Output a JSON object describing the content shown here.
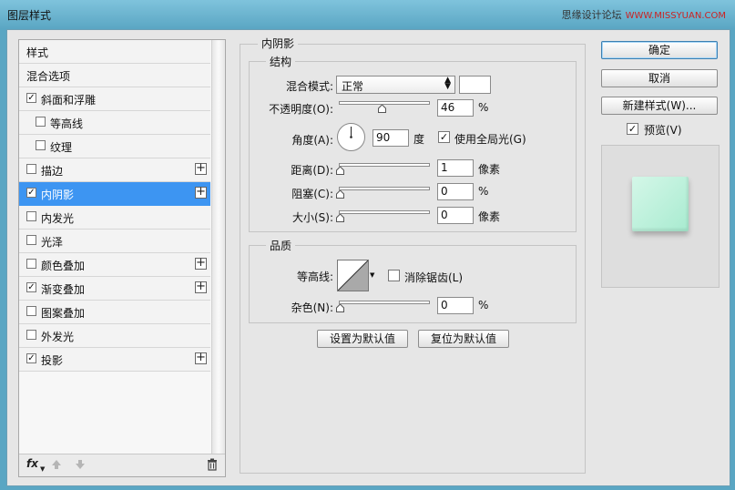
{
  "window": {
    "title": "图层样式"
  },
  "watermark": {
    "site": "思缘设计论坛",
    "url": "WWW.MISSYUAN.COM"
  },
  "style_list": {
    "items": [
      {
        "label": "样式",
        "checkbox": false,
        "checked": false,
        "indent": false,
        "plus": false,
        "selected": false
      },
      {
        "label": "混合选项",
        "checkbox": false,
        "checked": false,
        "indent": false,
        "plus": false,
        "selected": false
      },
      {
        "label": "斜面和浮雕",
        "checkbox": true,
        "checked": true,
        "indent": false,
        "plus": false,
        "selected": false
      },
      {
        "label": "等高线",
        "checkbox": true,
        "checked": false,
        "indent": true,
        "plus": false,
        "selected": false
      },
      {
        "label": "纹理",
        "checkbox": true,
        "checked": false,
        "indent": true,
        "plus": false,
        "selected": false
      },
      {
        "label": "描边",
        "checkbox": true,
        "checked": false,
        "indent": false,
        "plus": true,
        "selected": false
      },
      {
        "label": "内阴影",
        "checkbox": true,
        "checked": true,
        "indent": false,
        "plus": true,
        "selected": true
      },
      {
        "label": "内发光",
        "checkbox": true,
        "checked": false,
        "indent": false,
        "plus": false,
        "selected": false
      },
      {
        "label": "光泽",
        "checkbox": true,
        "checked": false,
        "indent": false,
        "plus": false,
        "selected": false
      },
      {
        "label": "颜色叠加",
        "checkbox": true,
        "checked": false,
        "indent": false,
        "plus": true,
        "selected": false
      },
      {
        "label": "渐变叠加",
        "checkbox": true,
        "checked": true,
        "indent": false,
        "plus": true,
        "selected": false
      },
      {
        "label": "图案叠加",
        "checkbox": true,
        "checked": false,
        "indent": false,
        "plus": false,
        "selected": false
      },
      {
        "label": "外发光",
        "checkbox": true,
        "checked": false,
        "indent": false,
        "plus": false,
        "selected": false
      },
      {
        "label": "投影",
        "checkbox": true,
        "checked": true,
        "indent": false,
        "plus": true,
        "selected": false
      }
    ],
    "footer": {
      "fx_label": "fx"
    }
  },
  "panel": {
    "title": "内阴影",
    "structure": {
      "title": "结构",
      "blend_mode_label": "混合模式:",
      "blend_mode_value": "正常",
      "shadow_color": "#ffffff",
      "opacity_label": "不透明度(O):",
      "opacity_value": "46",
      "opacity_unit": "%",
      "opacity_fraction": 0.46,
      "angle_label": "角度(A):",
      "angle_value": "90",
      "angle_unit": "度",
      "global_light_label": "使用全局光(G)",
      "global_light_checked": true,
      "distance_label": "距离(D):",
      "distance_value": "1",
      "distance_unit": "像素",
      "choke_label": "阻塞(C):",
      "choke_value": "0",
      "choke_unit": "%",
      "size_label": "大小(S):",
      "size_value": "0",
      "size_unit": "像素"
    },
    "quality": {
      "title": "品质",
      "contour_label": "等高线:",
      "anti_alias_label": "消除锯齿(L)",
      "anti_alias_checked": false,
      "noise_label": "杂色(N):",
      "noise_value": "0",
      "noise_unit": "%"
    },
    "set_default_label": "设置为默认值",
    "reset_default_label": "复位为默认值"
  },
  "buttons": {
    "ok_label": "确定",
    "cancel_label": "取消",
    "new_style_label": "新建样式(W)...",
    "preview_label": "预览(V)",
    "preview_checked": true
  },
  "colors": {
    "selection": "#3d95f2",
    "preview_fill": "#b5efd8",
    "title_bar": "#5aa6c3"
  }
}
